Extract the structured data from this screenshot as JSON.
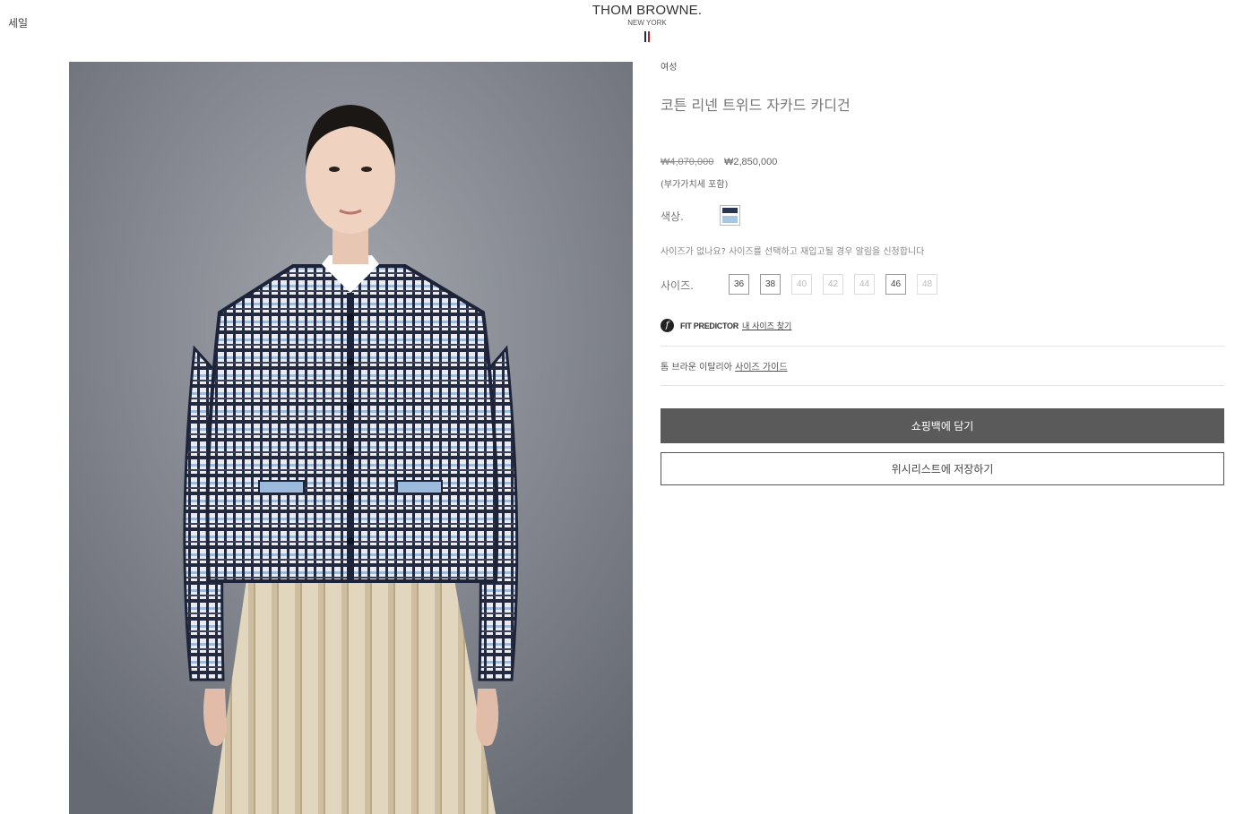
{
  "nav": {
    "sale_label": "세일"
  },
  "brand": {
    "name": "THOM BROWNE.",
    "sub": "NEW YORK",
    "flag_colors": [
      "#1d2a5c",
      "#ffffff",
      "#b21f2d"
    ]
  },
  "product": {
    "category": "여성",
    "title": "코튼 리넨 트위드 자카드 카디건",
    "price_original": "₩4,070,000",
    "price_sale": "₩2,850,000",
    "vat_note": "(부가가치세 포함)",
    "color_label": "색상.",
    "color_swatch": {
      "colors": [
        "#2b3550",
        "#ffffff",
        "#a8c6e0"
      ]
    },
    "size_notice": "사이즈가 없나요? 사이즈를 선택하고 재입고될 경우 알림을 신청합니다",
    "size_label": "사이즈.",
    "sizes": [
      {
        "label": "36",
        "available": true
      },
      {
        "label": "38",
        "available": true
      },
      {
        "label": "40",
        "available": false
      },
      {
        "label": "42",
        "available": false
      },
      {
        "label": "44",
        "available": false
      },
      {
        "label": "46",
        "available": true
      },
      {
        "label": "48",
        "available": false
      }
    ],
    "fit_predictor": {
      "icon": "f",
      "brand": "FIT PREDICTOR",
      "link": "내 사이즈 찾기"
    },
    "size_guide": {
      "prefix": "톰 브라운 이탈리아 ",
      "link": "사이즈 가이드"
    },
    "add_to_bag": "쇼핑백에 담기",
    "save_wishlist": "위시리스트에 저장하기"
  }
}
